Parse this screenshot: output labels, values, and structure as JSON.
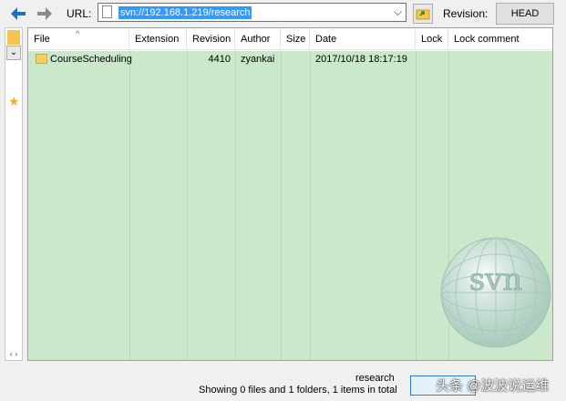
{
  "toolbar": {
    "url_label": "URL:",
    "url_value": "svn://192.168.1.219/research",
    "revision_label": "Revision:",
    "head_button": "HEAD"
  },
  "columns": [
    "File",
    "Extension",
    "Revision",
    "Author",
    "Size",
    "Date",
    "Lock",
    "Lock comment"
  ],
  "rows": [
    {
      "file": "CourseScheduling",
      "extension": "",
      "revision": "4410",
      "author": "zyankai",
      "size": "",
      "date": "2017/10/18 18:17:19",
      "lock": "",
      "lock_comment": ""
    }
  ],
  "watermark": {
    "logo_text": "svn"
  },
  "status": {
    "folder": "research",
    "summary": "Showing 0 files and 1 folders, 1 items in total"
  },
  "overlay": {
    "text": "头条 @波波说运维"
  },
  "colors": {
    "list_bg": "#cbe8cb",
    "selection": "#3399ff",
    "accent": "#1e6fc5"
  },
  "icons": [
    "back-arrow-icon",
    "forward-arrow-icon",
    "file-icon",
    "dropdown-icon",
    "go-folder-icon",
    "folder-icon",
    "star-icon",
    "svn-logo-icon"
  ]
}
